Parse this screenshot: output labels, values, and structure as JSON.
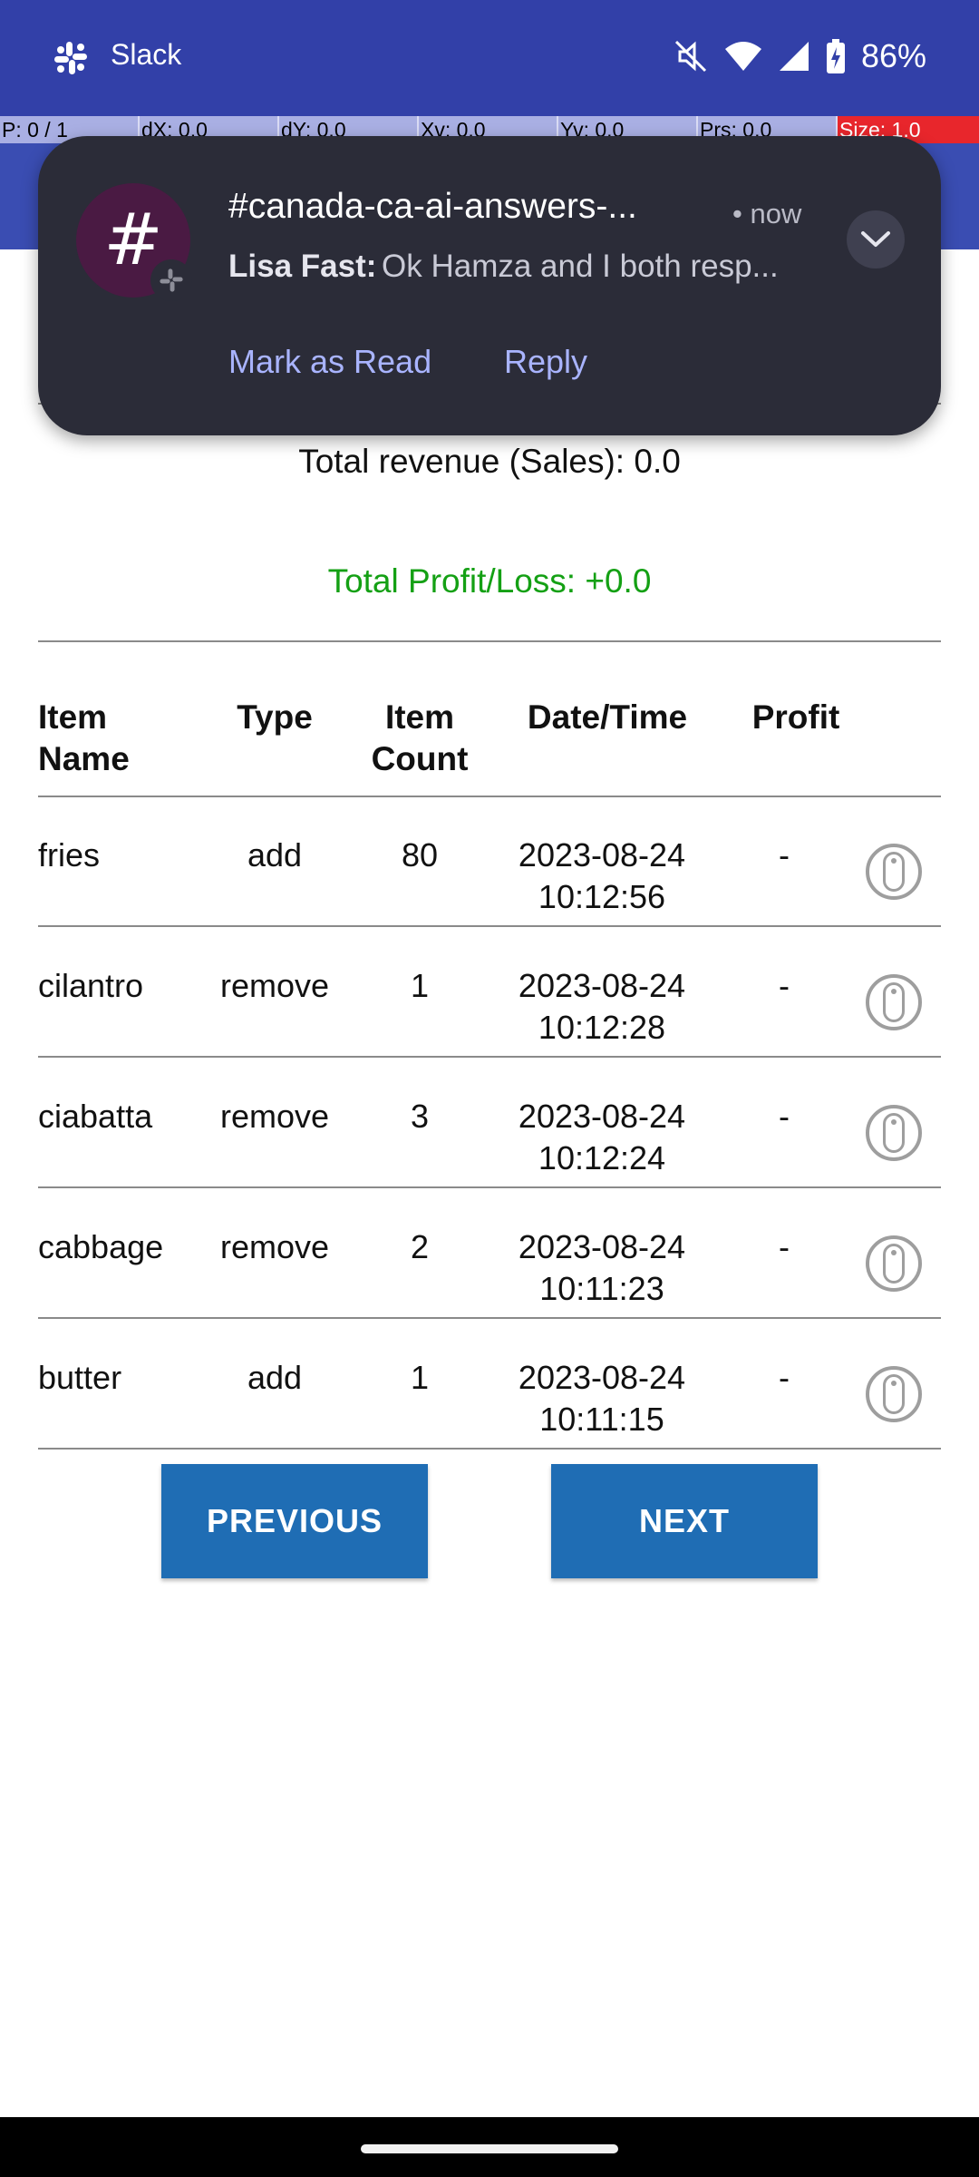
{
  "status_bar": {
    "app_name": "Slack",
    "battery": "86%",
    "icons": [
      "slack-icon",
      "mute-icon",
      "wifi-icon",
      "signal-icon",
      "battery-charging-icon"
    ],
    "color": "#3240a8"
  },
  "pointer_bar": {
    "cells": [
      "P: 0 / 1",
      "dX: 0.0",
      "dY: 0.0",
      "Xv: 0.0",
      "Yv: 0.0",
      "Prs: 0.0",
      "Size: 1.0"
    ]
  },
  "notification": {
    "avatar": "#",
    "channel": "#canada-ca-ai-answers-...",
    "time": "• now",
    "sender": "Lisa Fast:",
    "message": "Ok Hamza and I both resp...",
    "mark_as_read_label": "Mark as Read",
    "reply_label": "Reply"
  },
  "summary": {
    "revenue": "Total revenue (Sales): 0.0",
    "profit": "Total Profit/Loss: +0.0",
    "profit_color": "#14a014"
  },
  "table": {
    "headers": {
      "name": "Item\nName",
      "type": "Type",
      "count": "Item\nCount",
      "date": "Date/Time",
      "profit": "Profit"
    },
    "rows": [
      {
        "name": "fries",
        "type": "add",
        "count": "80",
        "date": "2023-08-24",
        "time": "10:12:56",
        "profit": "-"
      },
      {
        "name": "cilantro",
        "type": "remove",
        "count": "1",
        "date": "2023-08-24",
        "time": "10:12:28",
        "profit": "-"
      },
      {
        "name": "ciabatta",
        "type": "remove",
        "count": "3",
        "date": "2023-08-24",
        "time": "10:12:24",
        "profit": "-"
      },
      {
        "name": "cabbage",
        "type": "remove",
        "count": "2",
        "date": "2023-08-24",
        "time": "10:11:23",
        "profit": "-"
      },
      {
        "name": "butter",
        "type": "add",
        "count": "1",
        "date": "2023-08-24",
        "time": "10:11:15",
        "profit": "-"
      }
    ]
  },
  "pager": {
    "previous_label": "PREVIOUS",
    "next_label": "NEXT",
    "button_color": "#1f6db4"
  }
}
